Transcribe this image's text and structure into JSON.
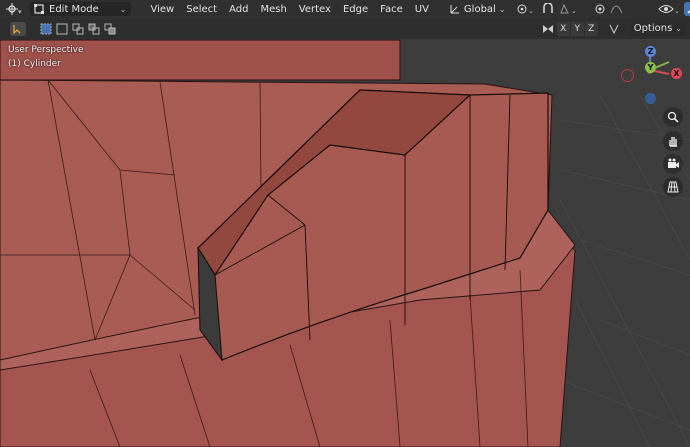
{
  "header": {
    "mode_label": "Edit Mode",
    "menus": [
      "View",
      "Select",
      "Add",
      "Mesh",
      "Vertex",
      "Edge",
      "Face",
      "UV"
    ],
    "orientation_label": "Global",
    "axes": [
      "X",
      "Y",
      "Z"
    ],
    "options_label": "Options"
  },
  "overlay": {
    "view_name": "User Perspective",
    "object_name": "(1) Cylinder"
  },
  "gizmo": {
    "z": "Z",
    "y": "Y",
    "x": "X"
  },
  "colors": {
    "mesh_face": "#a85a52",
    "mesh_side": "#8a3f3b",
    "background": "#3d3d3d",
    "header": "#303030",
    "accent": "#4772b3"
  },
  "icons": {
    "editor_type": "cursor-icon",
    "mode": "edit-mode-icon",
    "select_modes": [
      "vertex-select-icon",
      "edge-select-icon",
      "face-select-icon"
    ],
    "navigation": [
      "zoom-icon",
      "pan-hand-icon",
      "camera-icon",
      "grid-icon"
    ]
  }
}
